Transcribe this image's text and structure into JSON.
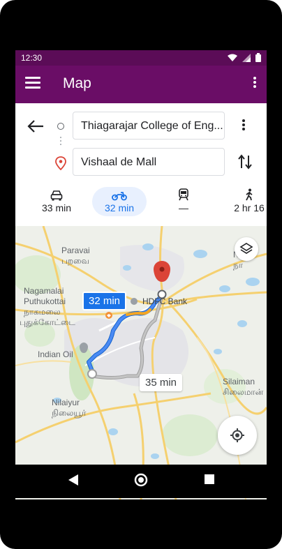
{
  "status_bar": {
    "time": "12:30"
  },
  "app_bar": {
    "title": "Map"
  },
  "directions": {
    "origin": "Thiagarajar College of Eng...",
    "destination": "Vishaal de Mall"
  },
  "modes": [
    {
      "name": "car",
      "label": "33 min"
    },
    {
      "name": "bike",
      "label": "32 min"
    },
    {
      "name": "transit",
      "label": "—"
    },
    {
      "name": "walk",
      "label": "2 hr 16"
    }
  ],
  "map": {
    "place_labels": [
      {
        "text": "Paravai"
      },
      {
        "text": "பறவை"
      },
      {
        "text": "Nagamalai"
      },
      {
        "text": "Puthukottai"
      },
      {
        "text": "நாகமலை"
      },
      {
        "text": "புதுக்கோட்டை"
      },
      {
        "text": "Indian Oil"
      },
      {
        "text": "Nilaiyur"
      },
      {
        "text": "நிலையூர்"
      },
      {
        "text": "HDFC Bank"
      },
      {
        "text": "Nara"
      },
      {
        "text": "நா"
      },
      {
        "text": "Silaiman"
      },
      {
        "text": "சிலைமான்"
      }
    ],
    "primary_route_label": "32 min",
    "alt_route_label": "35 min"
  },
  "colors": {
    "app_bar": "#6a0d66",
    "status_bar": "#5b0c57",
    "accent": "#1a73e8",
    "destination_pin": "#db4437"
  }
}
